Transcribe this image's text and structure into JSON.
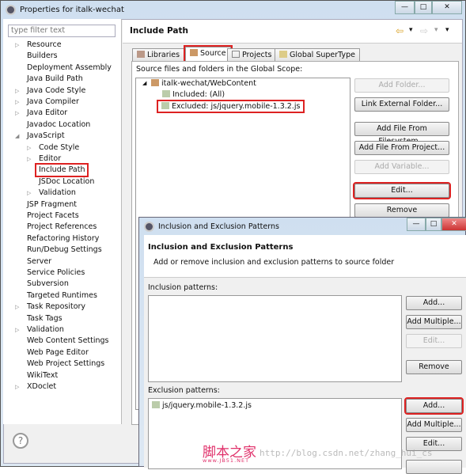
{
  "window": {
    "title": "Properties for italk-wechat",
    "min": "—",
    "max": "□",
    "close": "✕"
  },
  "sidebar": {
    "filter_placeholder": "type filter text",
    "items": [
      {
        "label": "Resource",
        "arrow": "▷",
        "level": 0
      },
      {
        "label": "Builders",
        "arrow": "",
        "level": 0
      },
      {
        "label": "Deployment Assembly",
        "arrow": "",
        "level": 0
      },
      {
        "label": "Java Build Path",
        "arrow": "",
        "level": 0
      },
      {
        "label": "Java Code Style",
        "arrow": "▷",
        "level": 0
      },
      {
        "label": "Java Compiler",
        "arrow": "▷",
        "level": 0
      },
      {
        "label": "Java Editor",
        "arrow": "▷",
        "level": 0
      },
      {
        "label": "Javadoc Location",
        "arrow": "",
        "level": 0
      },
      {
        "label": "JavaScript",
        "arrow": "◢",
        "level": 0
      },
      {
        "label": "Code Style",
        "arrow": "▷",
        "level": 1
      },
      {
        "label": "Editor",
        "arrow": "▷",
        "level": 1
      },
      {
        "label": "Include Path",
        "arrow": "",
        "level": 1,
        "selected": true
      },
      {
        "label": "JSDoc Location",
        "arrow": "",
        "level": 1
      },
      {
        "label": "Validation",
        "arrow": "▷",
        "level": 1
      },
      {
        "label": "JSP Fragment",
        "arrow": "",
        "level": 0
      },
      {
        "label": "Project Facets",
        "arrow": "",
        "level": 0
      },
      {
        "label": "Project References",
        "arrow": "",
        "level": 0
      },
      {
        "label": "Refactoring History",
        "arrow": "",
        "level": 0
      },
      {
        "label": "Run/Debug Settings",
        "arrow": "",
        "level": 0
      },
      {
        "label": "Server",
        "arrow": "",
        "level": 0
      },
      {
        "label": "Service Policies",
        "arrow": "",
        "level": 0
      },
      {
        "label": "Subversion",
        "arrow": "",
        "level": 0
      },
      {
        "label": "Targeted Runtimes",
        "arrow": "",
        "level": 0
      },
      {
        "label": "Task Repository",
        "arrow": "▷",
        "level": 0
      },
      {
        "label": "Task Tags",
        "arrow": "",
        "level": 0
      },
      {
        "label": "Validation",
        "arrow": "▷",
        "level": 0
      },
      {
        "label": "Web Content Settings",
        "arrow": "",
        "level": 0
      },
      {
        "label": "Web Page Editor",
        "arrow": "",
        "level": 0
      },
      {
        "label": "Web Project Settings",
        "arrow": "",
        "level": 0
      },
      {
        "label": "WikiText",
        "arrow": "",
        "level": 0
      },
      {
        "label": "XDoclet",
        "arrow": "▷",
        "level": 0
      }
    ],
    "help": "?"
  },
  "page": {
    "title": "Include Path",
    "nav": {
      "back": "⇦",
      "forward": "⇨",
      "dropdown": "▾"
    },
    "tabs": [
      "Libraries",
      "Source",
      "Projects",
      "Global SuperType"
    ],
    "active_tab": "Source",
    "source_label": "Source files and folders in the Global Scope:",
    "tree": {
      "root": "italk-wechat/WebContent",
      "included": "Included: (All)",
      "excluded": "Excluded: js/jquery.mobile-1.3.2.js"
    },
    "buttons": {
      "add_folder": "Add Folder...",
      "link_external": "Link External Folder...",
      "add_file_fs": "Add File From Filesystem...",
      "add_file_project": "Add File From Project...",
      "add_variable": "Add Variable...",
      "edit": "Edit...",
      "remove": "Remove"
    }
  },
  "dialog": {
    "title": "Inclusion and Exclusion Patterns",
    "heading": "Inclusion and Exclusion Patterns",
    "description": "Add or remove inclusion and exclusion patterns to source folder",
    "inclusion_label": "Inclusion patterns:",
    "exclusion_label": "Exclusion patterns:",
    "exclusion_items": [
      "js/jquery.mobile-1.3.2.js"
    ],
    "buttons": {
      "add": "Add...",
      "add_multiple": "Add Multiple...",
      "edit": "Edit...",
      "remove": "Remove"
    }
  },
  "watermark": {
    "logo": "脚本之家",
    "site": "www.JB51.NET",
    "url": "http://blog.csdn.net/zhang_hui_cs"
  },
  "colors": {
    "highlight": "#dd2222",
    "titlebar": "#cfdff0"
  }
}
